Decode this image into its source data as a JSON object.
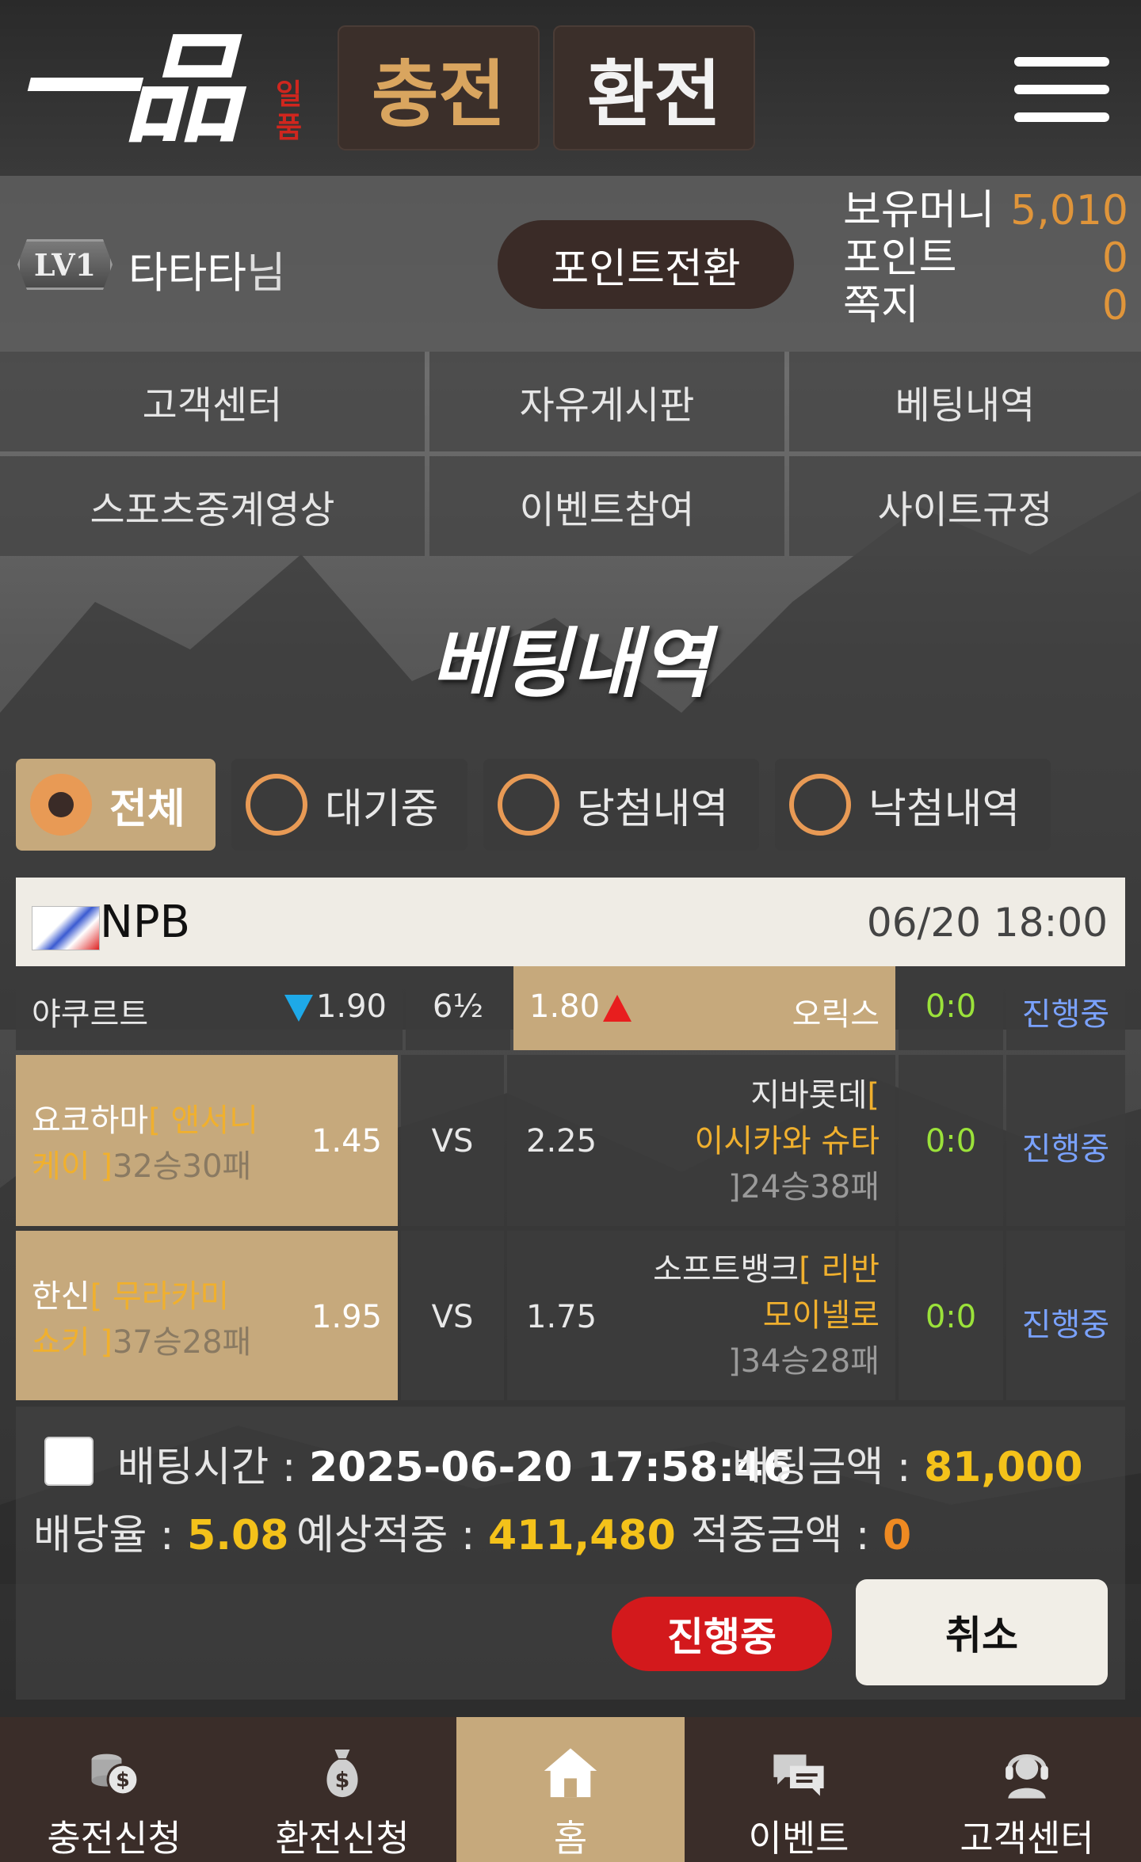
{
  "header": {
    "logo_main": "一品",
    "logo_sub": "일품",
    "charge_label": "충전",
    "exchange_label": "환전"
  },
  "user": {
    "level": "LV1",
    "name": "타타타",
    "suffix": "님",
    "point_convert_label": "포인트전환",
    "money_label": "보유머니",
    "money_value": "5,010",
    "point_label": "포인트",
    "point_value": "0",
    "message_label": "쪽지",
    "message_value": "0"
  },
  "menu": [
    "고객센터",
    "자유게시판",
    "베팅내역",
    "스포츠중계영상",
    "이벤트참여",
    "사이트규정"
  ],
  "section_title": "베팅내역",
  "tabs": [
    {
      "label": "전체",
      "active": true
    },
    {
      "label": "대기중",
      "active": false
    },
    {
      "label": "당첨내역",
      "active": false
    },
    {
      "label": "낙첨내역",
      "active": false
    }
  ],
  "league": {
    "name": "NPB",
    "time": "06/20 18:00"
  },
  "matches": [
    {
      "home": "야쿠르트",
      "home_odds": "1.90",
      "middle": "6½",
      "away_odds": "1.80",
      "away": "오릭스",
      "score": "0:0",
      "status": "진행중"
    },
    {
      "home": "요코하마",
      "home_pitcher_open": "[ ",
      "home_pitcher_1": "앤서니",
      "home_pitcher_2": "케이",
      "home_pitcher_close": " ]",
      "home_record": "32승30패",
      "home_odds": "1.45",
      "middle": "VS",
      "away_odds": "2.25",
      "away": "지바롯데",
      "away_pitcher_open": "[",
      "away_pitcher": "이시카와 슈타",
      "away_record_close": "]",
      "away_record": "24승38패",
      "score": "0:0",
      "status": "진행중"
    },
    {
      "home": "한신",
      "home_pitcher_open": "[ ",
      "home_pitcher_1": "무라카미",
      "home_pitcher_2": "쇼키",
      "home_pitcher_close": " ]",
      "home_record": "37승28패",
      "home_odds": "1.95",
      "middle": "VS",
      "away_odds": "1.75",
      "away": "소프트뱅크",
      "away_pitcher_open": "[ ",
      "away_pitcher_1": "리반",
      "away_pitcher_2": "모이넬로",
      "away_record_close": "]",
      "away_record": "34승28패",
      "score": "0:0",
      "status": "진행중"
    }
  ],
  "summary": {
    "bet_time_label": "배팅시간 : ",
    "bet_time_value": "2025-06-20 17:58:46",
    "bet_amount_label": "배팅금액 : ",
    "bet_amount_value": "81,000",
    "odds_label": "배당율 : ",
    "odds_value": "5.08",
    "expected_label": "예상적중 : ",
    "expected_value": "411,480",
    "win_label": "적중금액 : ",
    "win_value": "0",
    "progress_label": "진행중",
    "cancel_label": "취소"
  },
  "bottom_nav": [
    {
      "label": "충전신청",
      "icon": "coins-dollar-icon",
      "active": false
    },
    {
      "label": "환전신청",
      "icon": "money-bag-icon",
      "active": false
    },
    {
      "label": "홈",
      "icon": "home-icon",
      "active": true
    },
    {
      "label": "이벤트",
      "icon": "chat-bubbles-icon",
      "active": false
    },
    {
      "label": "고객센터",
      "icon": "headset-agent-icon",
      "active": false
    }
  ],
  "colors": {
    "gold": "#c6a97c",
    "orange_accent": "#e89a55",
    "money": "#e0953a",
    "score_green": "#9be23a",
    "status_blue": "#7aa2ff",
    "pitcher_gold": "#f0b02e",
    "progress_red": "#d3191c"
  }
}
